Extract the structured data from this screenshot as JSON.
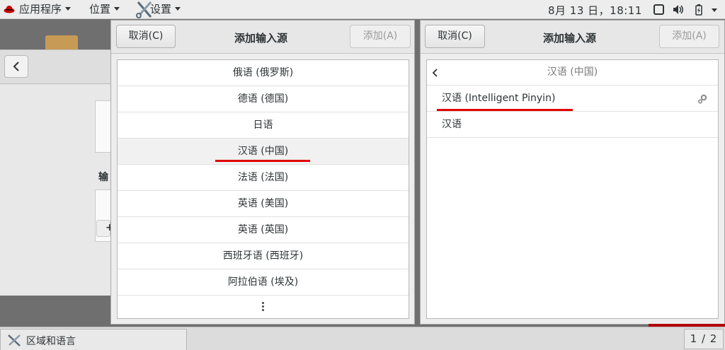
{
  "topbar": {
    "apps_label": "应用程序",
    "places_label": "位置",
    "settings_label": "设置",
    "clock": "8月 13 日，18:11",
    "tray_icons": [
      "window-icon",
      "volume-icon",
      "battery-icon",
      "chevron-down-icon"
    ]
  },
  "background_app": {
    "label_fragment": "输"
  },
  "dialog_left": {
    "cancel_label": "取消(C)",
    "title": "添加输入源",
    "add_label": "添加(A)",
    "languages": [
      "俄语 (俄罗斯)",
      "德语 (德国)",
      "日语",
      "汉语 (中国)",
      "法语 (法国)",
      "英语 (美国)",
      "英语 (英国)",
      "西班牙语 (西班牙)",
      "阿拉伯语 (埃及)"
    ],
    "selected_language": "汉语 (中国)"
  },
  "dialog_right": {
    "cancel_label": "取消(C)",
    "title": "添加输入源",
    "add_label": "添加(A)",
    "header": "汉语 (中国)",
    "sources": [
      "汉语 (Intelligent Pinyin)",
      "汉语"
    ],
    "highlighted_source": "汉语 (Intelligent Pinyin)"
  },
  "taskbar": {
    "window_label": "区域和语言",
    "pager": "1 / 2"
  },
  "colors": {
    "annotation": "#e00000",
    "accent_red": "#b30000"
  }
}
